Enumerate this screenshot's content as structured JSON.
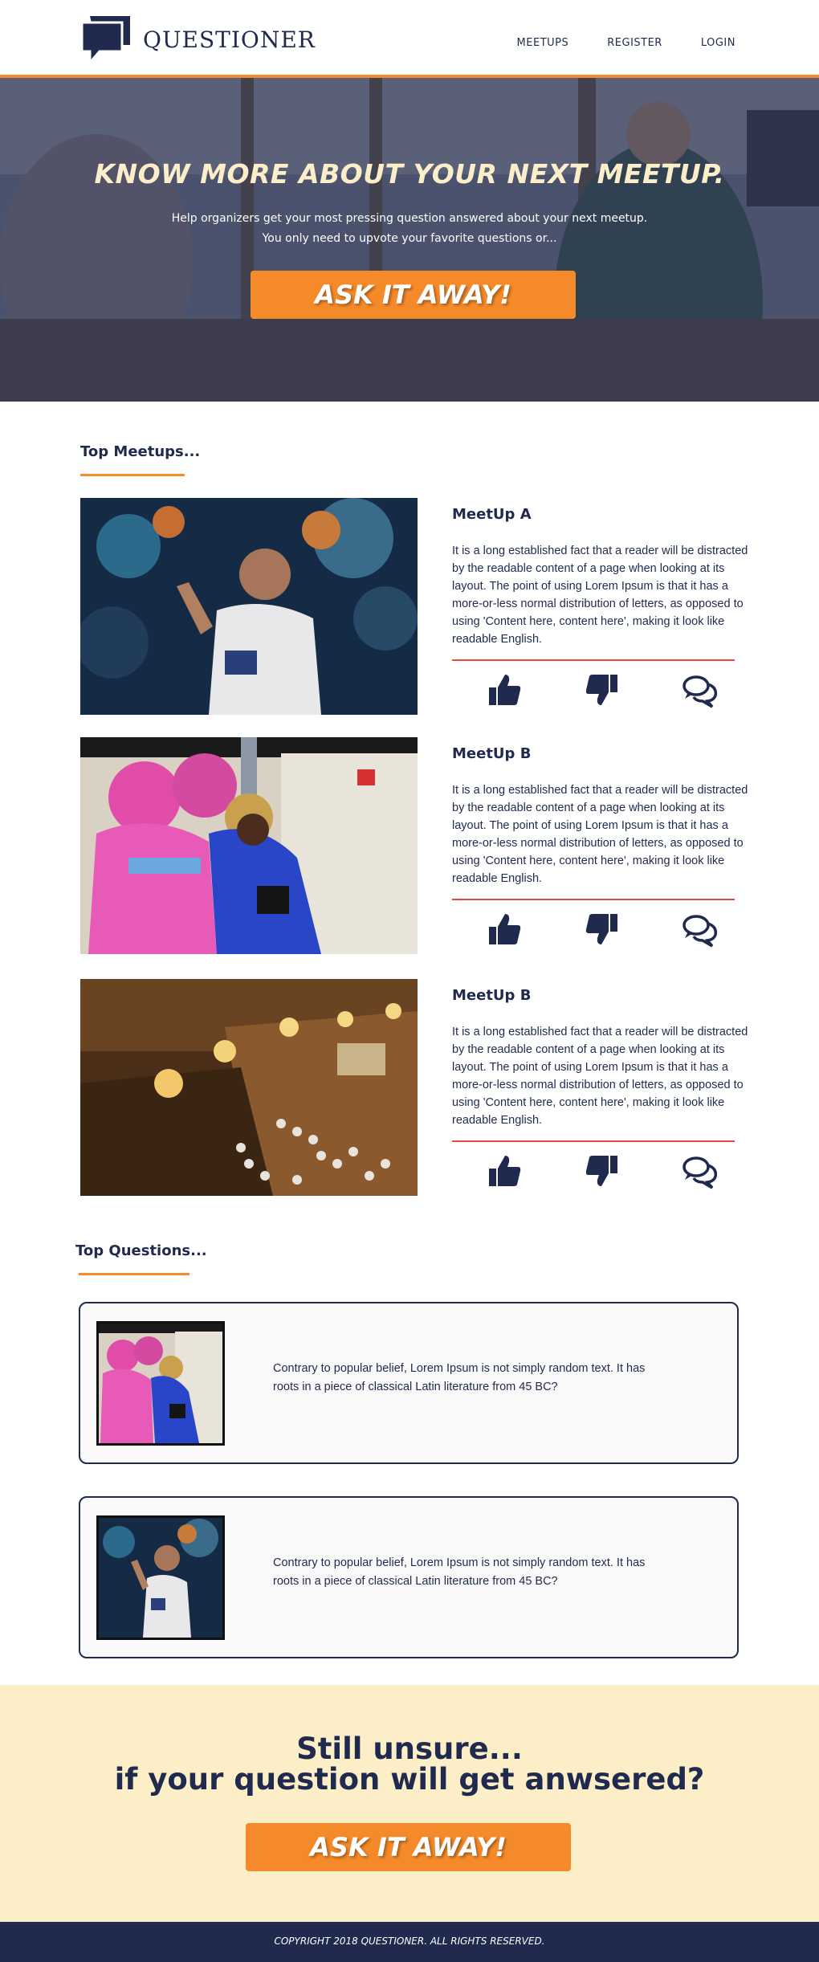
{
  "header": {
    "brand": "QUESTIONER",
    "nav": [
      "MEETUPS",
      "REGISTER",
      "LOGIN"
    ]
  },
  "hero": {
    "title": "KNOW MORE ABOUT YOUR NEXT MEETUP.",
    "subtitle_line1": "Help organizers get your most pressing question answered about your next meetup.",
    "subtitle_line2": "You  only need to upvote your favorite questions or...",
    "button": "ASK IT AWAY!"
  },
  "top_meetups": {
    "heading": "Top Meetups...",
    "items": [
      {
        "title": "MeetUp A",
        "description": "It is a long established fact that a reader will be distracted by the readable content of a page when looking at its layout. The point of using Lorem Ipsum is that it has a more-or-less normal distribution of letters, as opposed to using 'Content here, content here', making it look like readable English."
      },
      {
        "title": "MeetUp B",
        "description": "It is a long established fact that a reader will be distracted by the readable content of a page when looking at its layout. The point of using Lorem Ipsum is that it has a more-or-less normal distribution of letters, as opposed to using 'Content here, content here', making it look like readable English."
      },
      {
        "title": "MeetUp B",
        "description": "It is a long established fact that a reader will be distracted by the readable content of a page when looking at its layout. The point of using Lorem Ipsum is that it has a more-or-less normal distribution of letters, as opposed to using 'Content here, content here', making it look like readable English."
      }
    ],
    "action_icons": [
      "thumbs-up-icon",
      "thumbs-down-icon",
      "comments-icon"
    ]
  },
  "top_questions": {
    "heading": "Top Questions...",
    "items": [
      {
        "text": "Contrary to popular belief, Lorem Ipsum is not simply random text. It has roots in a piece of classical Latin literature from 45 BC?"
      },
      {
        "text": "Contrary to popular belief, Lorem Ipsum is not simply random text. It has roots in a piece of classical Latin literature from 45 BC?"
      }
    ]
  },
  "cta": {
    "line1": "Still unsure...",
    "line2": "if your question will get anwsered?",
    "button": "ASK IT AWAY!"
  },
  "footer": {
    "copyright": "COPYRIGHT 2018 QUESTIONER. ALL RIGHTS RESERVED."
  },
  "colors": {
    "navy": "#1f2a4e",
    "orange": "#f58a2a",
    "cream": "#fcefc8",
    "hero_title": "#fbeec9",
    "divider_red": "#e8473b"
  }
}
